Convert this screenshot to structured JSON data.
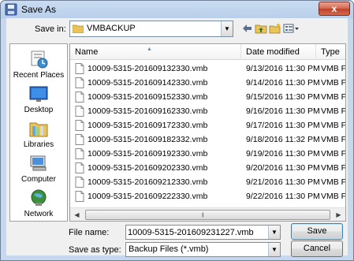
{
  "window": {
    "title": "Save As",
    "close_glyph": "x"
  },
  "toolbar": {
    "save_in_label": "Save in:",
    "save_in_value": "VMBACKUP",
    "icons": [
      "back-arrow-icon",
      "up-folder-icon",
      "new-folder-icon",
      "view-menu-icon"
    ]
  },
  "places": [
    {
      "label": "Recent Places",
      "icon": "recent-places-icon"
    },
    {
      "label": "Desktop",
      "icon": "desktop-icon"
    },
    {
      "label": "Libraries",
      "icon": "libraries-icon"
    },
    {
      "label": "Computer",
      "icon": "computer-icon"
    },
    {
      "label": "Network",
      "icon": "network-icon"
    }
  ],
  "columns": {
    "name": "Name",
    "date": "Date modified",
    "type": "Type"
  },
  "files": [
    {
      "name": "10009-5315-201609132330.vmb",
      "date": "9/13/2016 11:30 PM",
      "type": "VMB File"
    },
    {
      "name": "10009-5315-201609142330.vmb",
      "date": "9/14/2016 11:30 PM",
      "type": "VMB File"
    },
    {
      "name": "10009-5315-201609152330.vmb",
      "date": "9/15/2016 11:30 PM",
      "type": "VMB File"
    },
    {
      "name": "10009-5315-201609162330.vmb",
      "date": "9/16/2016 11:30 PM",
      "type": "VMB File"
    },
    {
      "name": "10009-5315-201609172330.vmb",
      "date": "9/17/2016 11:30 PM",
      "type": "VMB File"
    },
    {
      "name": "10009-5315-201609182332.vmb",
      "date": "9/18/2016 11:32 PM",
      "type": "VMB File"
    },
    {
      "name": "10009-5315-201609192330.vmb",
      "date": "9/19/2016 11:30 PM",
      "type": "VMB File"
    },
    {
      "name": "10009-5315-201609202330.vmb",
      "date": "9/20/2016 11:30 PM",
      "type": "VMB File"
    },
    {
      "name": "10009-5315-201609212330.vmb",
      "date": "9/21/2016 11:30 PM",
      "type": "VMB File"
    },
    {
      "name": "10009-5315-201609222330.vmb",
      "date": "9/22/2016 11:30 PM",
      "type": "VMB File"
    }
  ],
  "form": {
    "file_name_label": "File name:",
    "file_name_value": "10009-5315-201609231227.vmb",
    "save_as_type_label": "Save as type:",
    "save_as_type_value": "Backup Files (*.vmb)"
  },
  "buttons": {
    "save": "Save",
    "cancel": "Cancel"
  }
}
